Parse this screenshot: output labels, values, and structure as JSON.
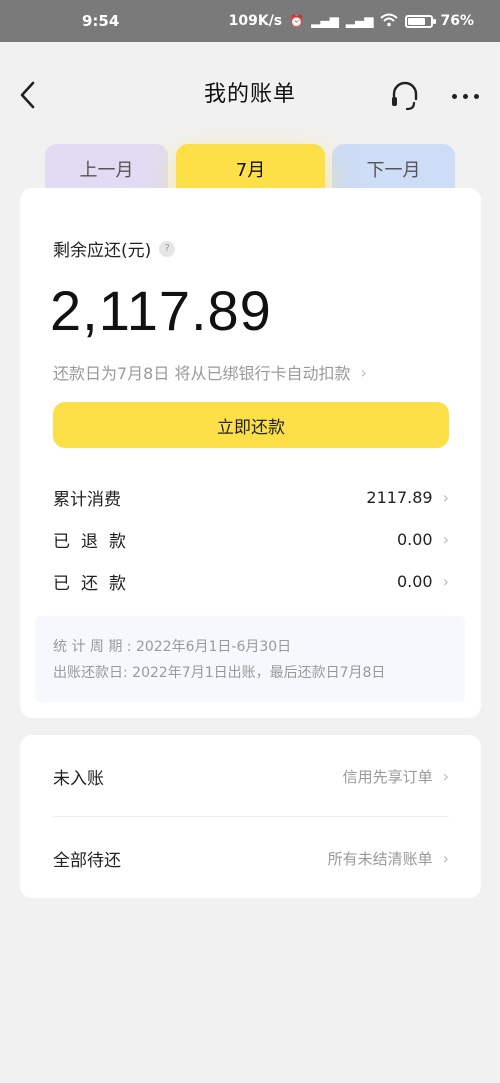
{
  "status_bar": {
    "time": "9:54",
    "net_speed": "109K/s",
    "battery": "76",
    "battery_pct": 76
  },
  "header": {
    "title": "我的账单"
  },
  "tabs": {
    "prev": "上一月",
    "current": "7月",
    "next": "下一月"
  },
  "bill": {
    "remain_label": "剩余应还(元)",
    "help": "?",
    "amount": "2,117.89",
    "due_note": "还款日为7月8日 将从已绑银行卡自动扣款",
    "pay_button": "立即还款",
    "rows": [
      {
        "label": "累计消费",
        "value": "2117.89"
      },
      {
        "label": "已退款",
        "value": "0.00"
      },
      {
        "label": "已还款",
        "value": "0.00"
      }
    ],
    "summary": {
      "period": "统 计 周 期 : 2022年6月1日-6月30日",
      "billing": "出账还款日: 2022年7月1日出账，最后还款日7月8日"
    }
  },
  "list": [
    {
      "label": "未入账",
      "hint": "信用先享订单"
    },
    {
      "label": "全部待还",
      "hint": "所有未结清账单"
    }
  ],
  "colors": {
    "accent": "#fde047",
    "tab_prev": "#e1dcf3",
    "tab_next": "#cddcf7",
    "background": "#f1f1f1"
  }
}
